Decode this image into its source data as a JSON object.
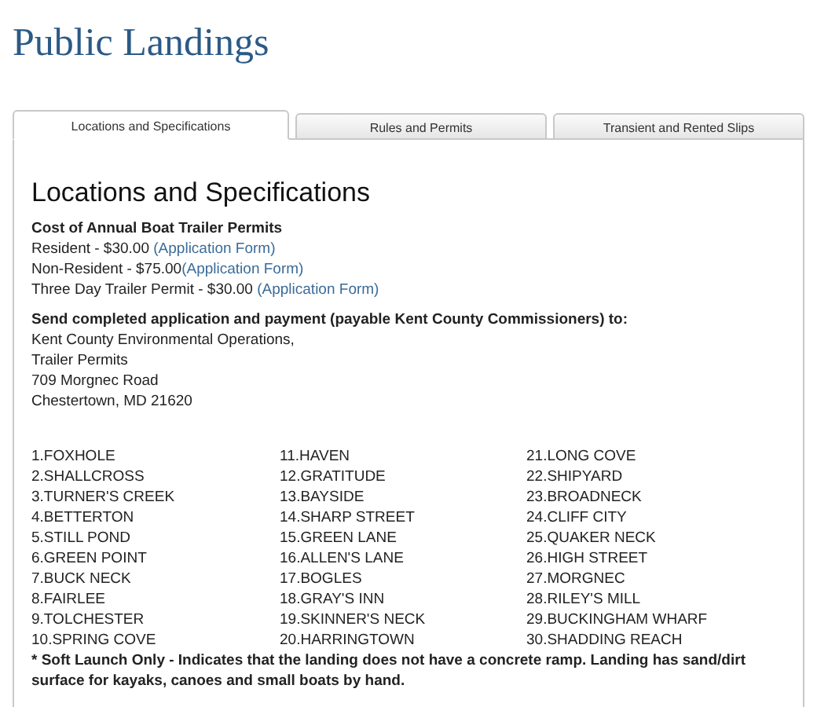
{
  "page_title": "Public Landings",
  "tabs": [
    {
      "label": "Locations and Specifications",
      "selected": true
    },
    {
      "label": "Rules and Permits",
      "selected": false
    },
    {
      "label": "Transient and Rented Slips",
      "selected": false
    }
  ],
  "section_title": "Locations and Specifications",
  "permits": {
    "heading": "Cost of Annual Boat Trailer Permits",
    "items": [
      {
        "text": "Resident - $30.00 ",
        "link": "(Application Form)"
      },
      {
        "text": "Non-Resident - $75.00",
        "link": "(Application Form)"
      },
      {
        "text": "Three Day Trailer Permit - $30.00 ",
        "link": "(Application Form)"
      }
    ]
  },
  "mailing": {
    "heading": "Send completed application and payment (payable Kent County Commissioners) to:",
    "lines": [
      "Kent County Environmental Operations,",
      "Trailer Permits",
      "709 Morgnec Road",
      "Chestertown, MD 21620"
    ]
  },
  "landing_columns": [
    [
      "1.FOXHOLE",
      "2.SHALLCROSS",
      "3.TURNER'S CREEK",
      "4.BETTERTON",
      "5.STILL POND",
      "6.GREEN POINT",
      "7.BUCK NECK",
      "8.FAIRLEE",
      "9.TOLCHESTER",
      "10.SPRING COVE"
    ],
    [
      "11.HAVEN",
      "12.GRATITUDE",
      "13.BAYSIDE",
      "14.SHARP STREET",
      "15.GREEN LANE",
      "16.ALLEN'S LANE",
      "17.BOGLES",
      "18.GRAY'S INN",
      "19.SKINNER'S NECK",
      "20.HARRINGTOWN"
    ],
    [
      "21.LONG COVE",
      "22.SHIPYARD",
      "23.BROADNECK",
      "24.CLIFF CITY",
      "25.QUAKER NECK",
      "26.HIGH STREET",
      "27.MORGNEC",
      "28.RILEY'S MILL",
      "29.BUCKINGHAM WHARF",
      "30.SHADDING REACH"
    ]
  ],
  "footnote": "* Soft Launch Only - Indicates that the landing does not have a concrete ramp.  Landing has sand/dirt surface for kayaks, canoes and small boats by hand."
}
